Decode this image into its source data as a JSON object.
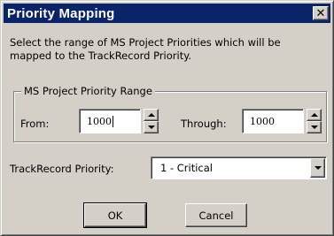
{
  "window": {
    "title": "Priority Mapping",
    "close_glyph": "✕"
  },
  "instructions": "Select the range of MS Project Priorities which will be mapped to the TrackRecord Priority.",
  "range_group": {
    "legend": "MS Project Priority Range",
    "from_label": "From:",
    "from_value": "1000",
    "through_label": "Through:",
    "through_value": "1000"
  },
  "trackrecord_priority": {
    "label": "TrackRecord Priority:",
    "selected": "1 - Critical"
  },
  "buttons": {
    "ok": "OK",
    "cancel": "Cancel"
  },
  "icons": {
    "spin_up": "spin-up-arrow-icon",
    "spin_down": "spin-down-arrow-icon",
    "dropdown": "chevron-down-icon",
    "close": "close-icon"
  }
}
